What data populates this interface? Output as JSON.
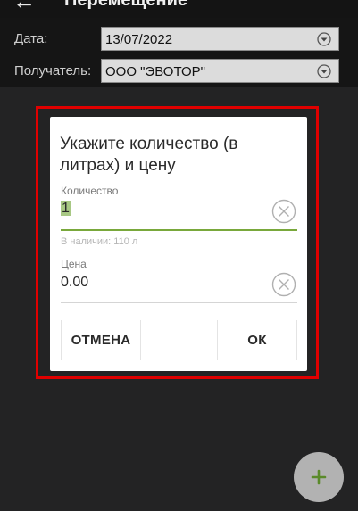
{
  "header": {
    "title": "Перемещение",
    "back_icon": "arrow-left-icon"
  },
  "form": {
    "date_label": "Дата:",
    "date_value": "13/07/2022",
    "recipient_label": "Получатель:",
    "recipient_value": "ООО \"ЭВОТОР\"",
    "dropdown_icon": "chevron-down-icon"
  },
  "dialog": {
    "title": "Укажите количество (в литрах) и цену",
    "quantity_label": "Количество",
    "quantity_value": "1",
    "quantity_hint": "В наличии: 110 л",
    "price_label": "Цена",
    "price_value": "0.00",
    "clear_icon": "clear-icon",
    "cancel_label": "ОТМЕНА",
    "ok_label": "ОК"
  },
  "fab": {
    "icon": "plus-icon"
  },
  "colors": {
    "accent": "#79a83b",
    "highlight": "#e00000",
    "selection": "#a8c884"
  }
}
